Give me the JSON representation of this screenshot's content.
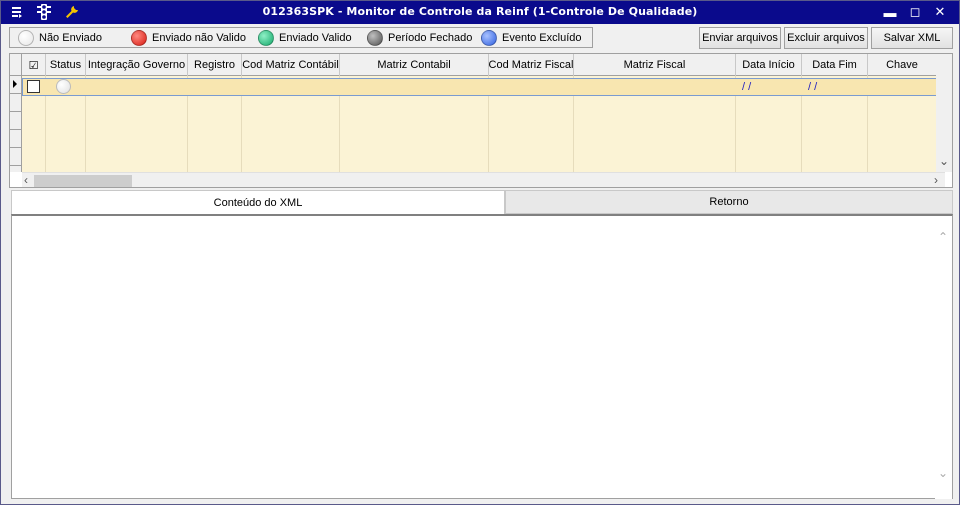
{
  "window": {
    "title": "012363SPK - Monitor de Controle da Reinf (1-Controle De Qualidade)",
    "icons": [
      "menu-icon",
      "traffic-light-icon",
      "wrench-icon"
    ],
    "controls": {
      "minimize": "▬",
      "maximize": "◻",
      "close": "✕"
    }
  },
  "legend": [
    {
      "label": "Não Enviado",
      "color": "#f4f4f4"
    },
    {
      "label": "Enviado não Valido",
      "color": "#e8261e"
    },
    {
      "label": "Enviado Valido",
      "color": "#1fbf7a"
    },
    {
      "label": "Período Fechado",
      "color": "#6a6a6a"
    },
    {
      "label": "Evento Excluído",
      "color": "#3f6fe8"
    }
  ],
  "toolbar": {
    "send_label": "Enviar arquivos",
    "delete_label": "Excluir arquivos",
    "save_label": "Salvar XML"
  },
  "grid": {
    "check_header": "☑",
    "columns": [
      "Status",
      "Integração Governo",
      "Registro",
      "Cod Matriz Contábil",
      "Matriz Contabil",
      "Cod Matriz Fiscal",
      "Matriz Fiscal",
      "Data Início",
      "Data Fim",
      "Chave"
    ],
    "row": {
      "data_inicio": "/ /",
      "data_fim": "/ /"
    }
  },
  "tabs": [
    {
      "label": "Conteúdo do XML"
    },
    {
      "label": "Retorno"
    }
  ]
}
